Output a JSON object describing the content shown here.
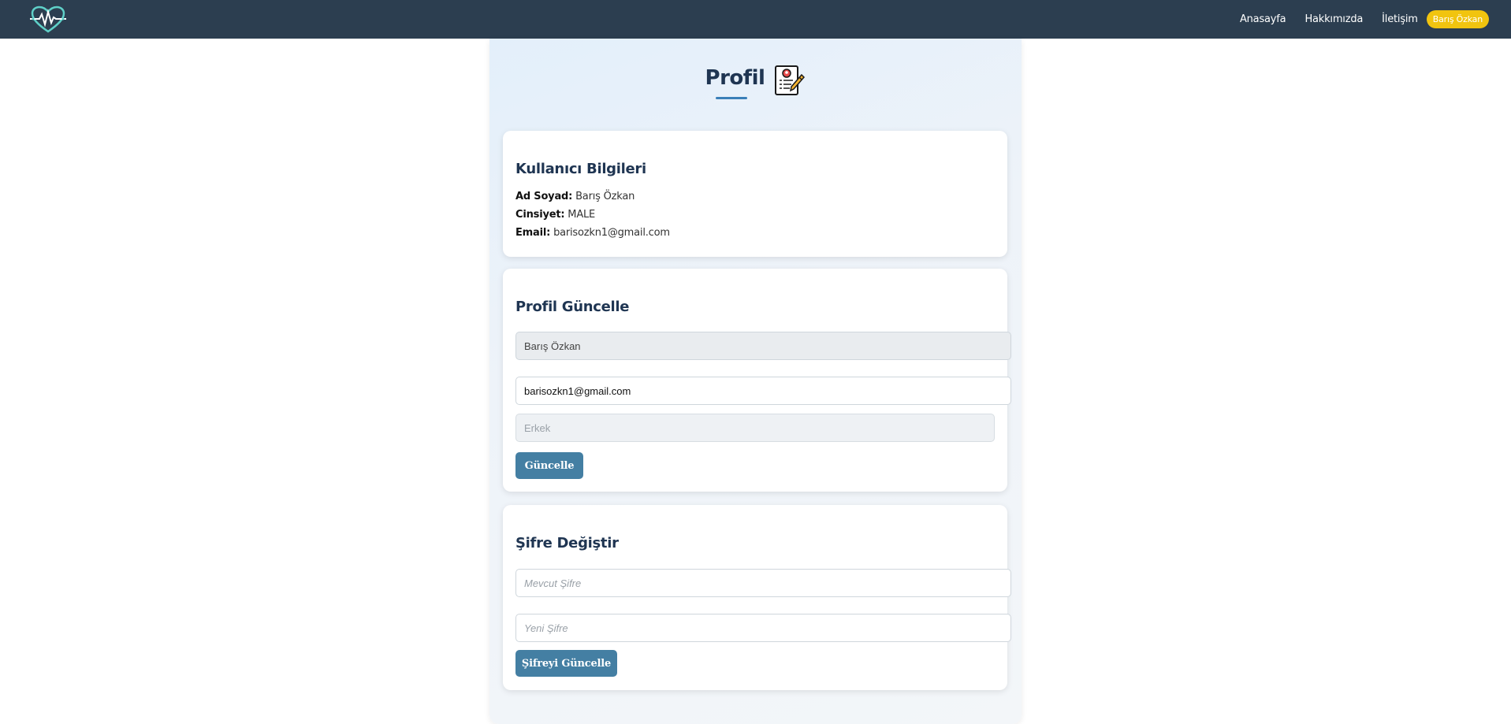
{
  "nav": {
    "logo_icon": "heartbeat-icon",
    "links": [
      "Anasayfa",
      "Hakkımızda",
      "İletişim"
    ],
    "user_badge": "Barış Özkan"
  },
  "header": {
    "title": "Profil",
    "icon": "profile-document-pen-icon"
  },
  "user_info": {
    "title": "Kullanıcı Bilgileri",
    "name_label": "Ad Soyad:",
    "name_value": "Barış Özkan",
    "gender_label": "Cinsiyet:",
    "gender_value": "MALE",
    "email_label": "Email:",
    "email_value": "barisozkn1@gmail.com"
  },
  "profile_update": {
    "title": "Profil Güncelle",
    "name_field": "Barış Özkan",
    "email_field": "barisozkn1@gmail.com",
    "gender_select": "Erkek",
    "submit_label": "Güncelle"
  },
  "password_change": {
    "title": "Şifre Değiştir",
    "current_placeholder": "Mevcut Şifre",
    "new_placeholder": "Yeni Şifre",
    "submit_label": "Şifreyi Güncelle"
  },
  "colors": {
    "navbar": "#2c3e50",
    "badge": "#f1c40f",
    "button": "#447fa3",
    "heading": "#1f3552"
  }
}
